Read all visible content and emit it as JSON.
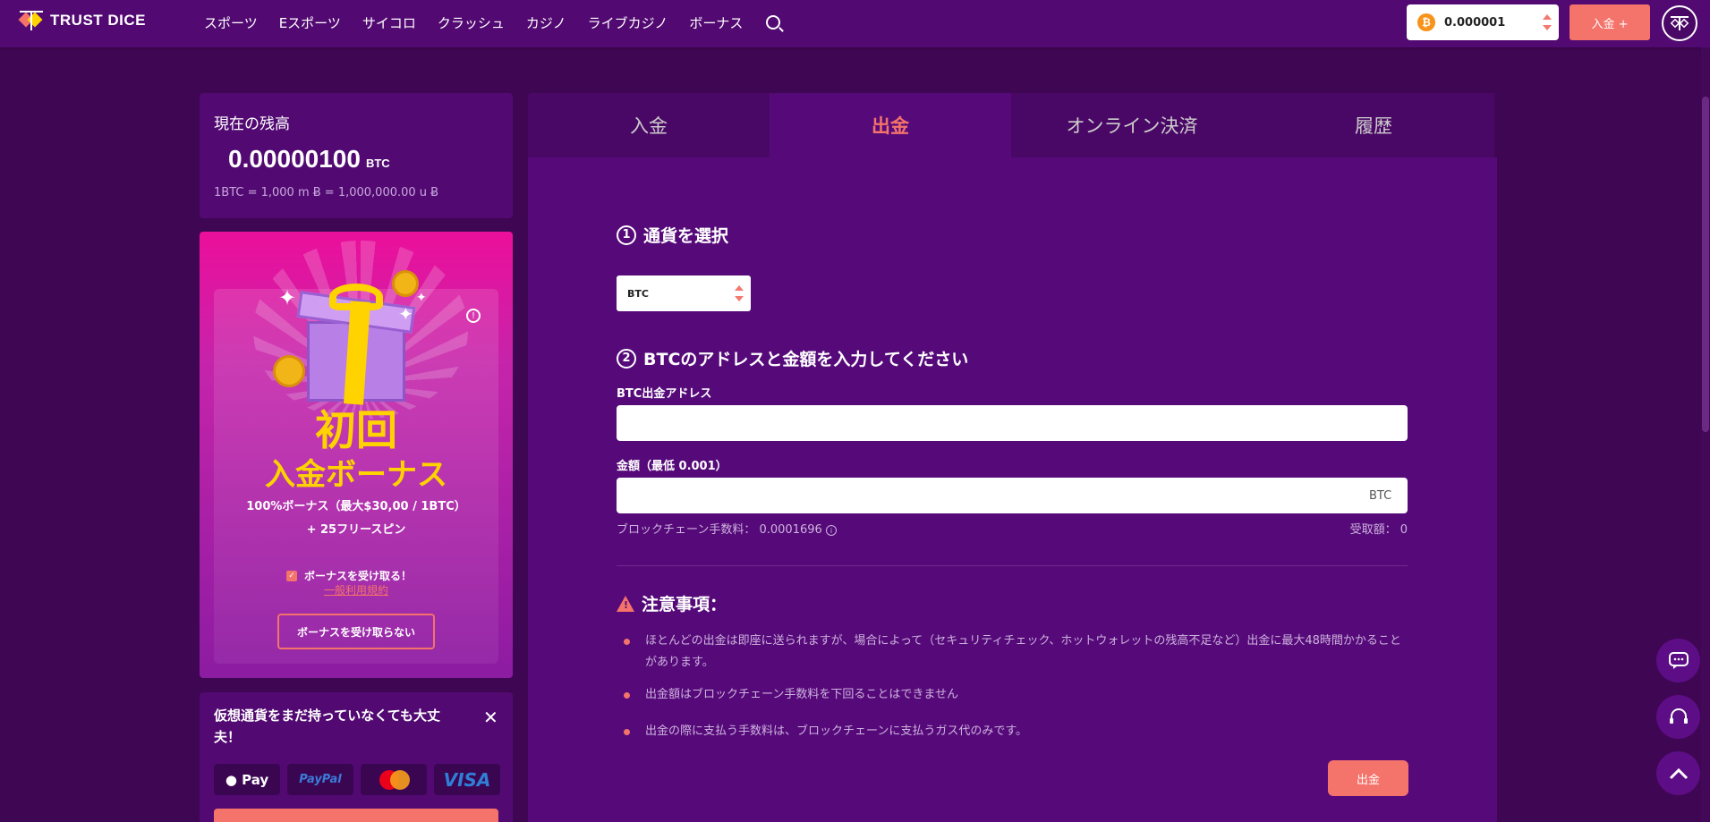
{
  "header": {
    "logo_text": "TRUST DICE",
    "nav": [
      "スポーツ",
      "Eスポーツ",
      "サイコロ",
      "クラッシュ",
      "カジノ",
      "ライブカジノ",
      "ボーナス"
    ],
    "balance": "0.000001",
    "deposit_label": "入金 +"
  },
  "balance_card": {
    "title": "現在の残高",
    "amount": "0.00000100",
    "unit": "BTC",
    "conversion": "1BTC = 1,000 m Ƀ = 1,000,000.00 u Ƀ"
  },
  "bonus": {
    "title1": "初回",
    "title2": "入金ボーナス",
    "desc": "100%ボーナス（最大$30,00 / 1BTC）",
    "spins": "+ 25フリースピン",
    "checkbox_label": "ボーナスを受け取る！",
    "terms": "一般利用規約",
    "decline": "ボーナスを受け取らない"
  },
  "crypto_card": {
    "text": "仮想通貨をまだ持っていなくても大丈夫！",
    "payments": [
      "Pay",
      "PayPal",
      "",
      "VISA"
    ]
  },
  "tabs": [
    "入金",
    "出金",
    "オンライン決済",
    "履歴"
  ],
  "active_tab": 1,
  "withdraw": {
    "step1_num": "1",
    "step1_title": "通貨を選択",
    "currency": "BTC",
    "step2_num": "2",
    "step2_title": "BTCのアドレスと金額を入力してください",
    "address_label": "BTC出金アドレス",
    "address_value": "",
    "amount_label": "金額（最低 0.001）",
    "amount_value": "",
    "amount_suffix": "BTC",
    "fee_label": "ブロックチェーン手数料： 0.0001696",
    "receive_label": "受取額： 0",
    "notice_title": "注意事項：",
    "notes": [
      "ほとんどの出金は即座に送られますが、場合によって（セキュリティチェック、ホットウォレットの残高不足など）出金に最大48時間かかることがあります。",
      "出金額はブロックチェーン手数料を下回ることはできません",
      "出金の際に支払う手数料は、ブロックチェーンに支払うガス代のみです。"
    ],
    "button": "出金"
  },
  "colors": {
    "accent": "#f4736a",
    "header_bg": "#520a72",
    "page_bg": "#3f0653",
    "bonus_yellow": "#ffd300"
  }
}
